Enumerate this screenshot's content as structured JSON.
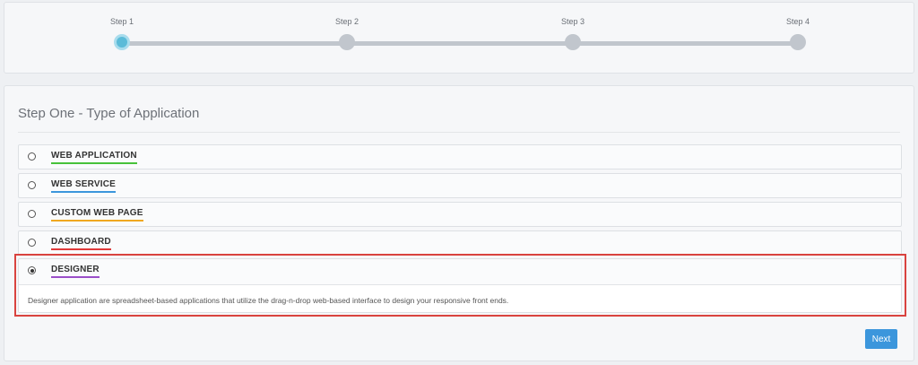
{
  "stepper": {
    "steps": [
      {
        "label": "Step 1",
        "active": true
      },
      {
        "label": "Step 2",
        "active": false
      },
      {
        "label": "Step 3",
        "active": false
      },
      {
        "label": "Step 4",
        "active": false
      }
    ]
  },
  "main": {
    "title": "Step One - Type of Application",
    "options": [
      {
        "label": "WEB APPLICATION",
        "underline_color": "#47c23a",
        "checked": false
      },
      {
        "label": "WEB SERVICE",
        "underline_color": "#3c96dc",
        "checked": false
      },
      {
        "label": "CUSTOM WEB PAGE",
        "underline_color": "#f0a820",
        "checked": false
      },
      {
        "label": "DASHBOARD",
        "underline_color": "#e03a3a",
        "checked": false
      },
      {
        "label": "DESIGNER",
        "underline_color": "#9b4fc8",
        "checked": true,
        "description": "Designer application are spreadsheet-based applications that utilize the drag-n-drop web-based interface to design your responsive front ends."
      }
    ],
    "next_label": "Next"
  },
  "colors": {
    "accent": "#3c96dc",
    "active_step": "#5bbbd8",
    "highlight": "#d9433f"
  }
}
